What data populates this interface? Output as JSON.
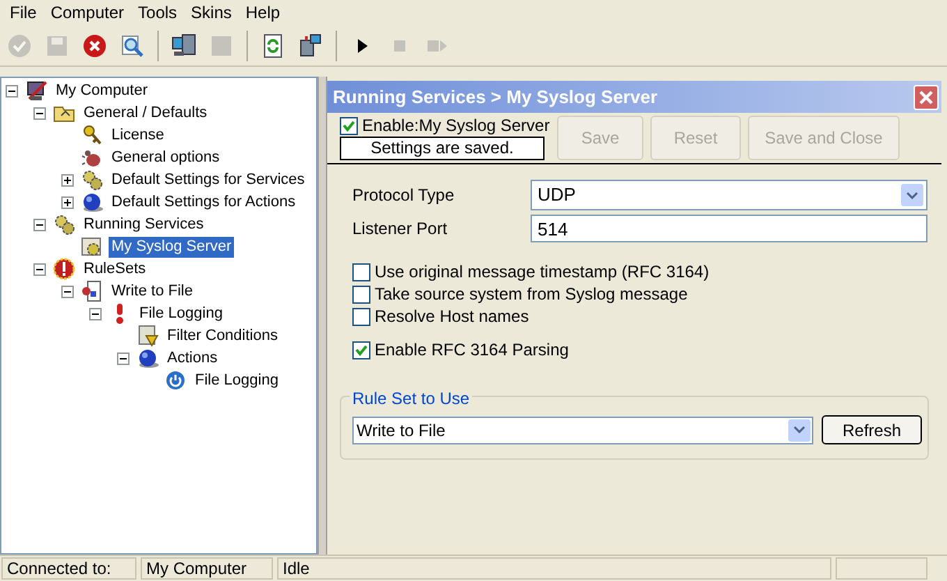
{
  "menu": [
    "File",
    "Computer",
    "Tools",
    "Skins",
    "Help"
  ],
  "toolbar": [
    {
      "kind": "check",
      "disabled": true
    },
    {
      "kind": "save",
      "disabled": true
    },
    {
      "kind": "delete",
      "disabled": false
    },
    {
      "kind": "search",
      "disabled": false
    },
    {
      "kind": "sep"
    },
    {
      "kind": "computers",
      "disabled": false
    },
    {
      "kind": "square",
      "disabled": true
    },
    {
      "kind": "sep"
    },
    {
      "kind": "refresh",
      "disabled": false
    },
    {
      "kind": "network",
      "disabled": false
    },
    {
      "kind": "sep"
    },
    {
      "kind": "play",
      "disabled": false
    },
    {
      "kind": "stop",
      "disabled": true
    },
    {
      "kind": "step",
      "disabled": true
    }
  ],
  "tree": [
    {
      "label": "My Computer",
      "kind": "computer",
      "selected": false,
      "expanded": true,
      "children": [
        {
          "label": "General / Defaults",
          "kind": "folder",
          "selected": false,
          "expanded": true,
          "children": [
            {
              "label": "License",
              "kind": "keys",
              "selected": false
            },
            {
              "label": "General options",
              "kind": "bug",
              "selected": false
            },
            {
              "label": "Default Settings for Services",
              "kind": "gears",
              "selected": false,
              "expanded": false
            },
            {
              "label": "Default Settings for Actions",
              "kind": "globe",
              "selected": false,
              "expanded": false
            }
          ]
        },
        {
          "label": "Running Services",
          "kind": "gears",
          "selected": false,
          "expanded": true,
          "children": [
            {
              "label": "My Syslog Server",
              "kind": "service",
              "selected": true
            }
          ]
        },
        {
          "label": "RuleSets",
          "kind": "alert",
          "selected": false,
          "expanded": true,
          "children": [
            {
              "label": "Write to File",
              "kind": "ruleset",
              "selected": false,
              "expanded": true,
              "children": [
                {
                  "label": "File Logging",
                  "kind": "rule",
                  "selected": false,
                  "expanded": true,
                  "children": [
                    {
                      "label": "Filter Conditions",
                      "kind": "filter",
                      "selected": false
                    },
                    {
                      "label": "Actions",
                      "kind": "globe",
                      "selected": false,
                      "expanded": true,
                      "children": [
                        {
                          "label": "File Logging",
                          "kind": "power",
                          "selected": false
                        }
                      ]
                    }
                  ]
                }
              ]
            }
          ]
        }
      ]
    }
  ],
  "panel": {
    "title": "Running Services > My Syslog Server",
    "enable": {
      "label": "Enable:My Syslog Server",
      "checked": true
    },
    "status": "Settings are saved.",
    "buttons": [
      {
        "label": "Save",
        "disabled": true
      },
      {
        "label": "Reset",
        "disabled": true
      },
      {
        "label": "Save and Close",
        "disabled": true
      }
    ],
    "protocol": {
      "label": "Protocol Type",
      "value": "UDP"
    },
    "port": {
      "label": "Listener Port",
      "value": "514"
    },
    "options": [
      {
        "label": "Use original message timestamp (RFC 3164)",
        "checked": false
      },
      {
        "label": "Take source system from Syslog message",
        "checked": false
      },
      {
        "label": "Resolve Host names",
        "checked": false
      },
      {
        "label": "Enable RFC 3164 Parsing",
        "checked": true
      }
    ],
    "ruleset": {
      "title": "Rule Set to Use",
      "value": "Write to File",
      "button": "Refresh"
    }
  },
  "status_bar": [
    "Connected to:",
    "My Computer",
    "Idle"
  ]
}
